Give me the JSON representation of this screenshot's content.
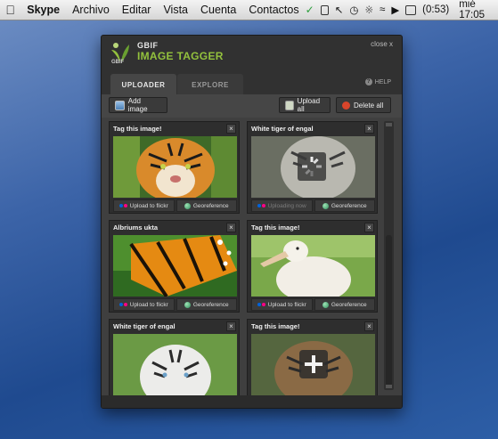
{
  "menubar": {
    "app_name": "Skype",
    "items": [
      "Archivo",
      "Editar",
      "Vista",
      "Cuenta",
      "Contactos"
    ],
    "battery": "(0:53)",
    "clock": "mié 17:05"
  },
  "window": {
    "logo_small": "GBIF",
    "logo_brand": "GBIF",
    "logo_title": "IMAGE TAGGER",
    "close_label": "close  x",
    "tabs": [
      {
        "label": "UPLOADER",
        "active": true
      },
      {
        "label": "EXPLORE",
        "active": false
      }
    ],
    "help_label": "HELP",
    "toolbar": {
      "add_image": "Add image",
      "upload_all": "Upload all",
      "delete_all": "Delete all"
    },
    "cards": [
      {
        "title": "Tag this image!",
        "upload": "Upload to flickr",
        "geo": "Georeference",
        "state": "ready",
        "image": "bengal-tiger"
      },
      {
        "title": "White tiger of engal",
        "upload": "Uploading now",
        "geo": "Georeference",
        "state": "uploading",
        "image": "white-tiger-faded"
      },
      {
        "title": "Albriums ukta",
        "upload": "Upload to flickr",
        "geo": "Georeference",
        "state": "ready",
        "image": "monarch-butterfly"
      },
      {
        "title": "Tag this image!",
        "upload": "Upload to flickr",
        "geo": "Georeference",
        "state": "ready",
        "image": "pelican"
      },
      {
        "title": "White tiger of engal",
        "upload": "",
        "geo": "",
        "state": "partial",
        "image": "white-tiger"
      },
      {
        "title": "Tag this image!",
        "upload": "",
        "geo": "",
        "state": "add",
        "image": "tiger-plus"
      }
    ],
    "colors": {
      "accent_green": "#93c13d",
      "flickr_blue": "#0063dc",
      "flickr_pink": "#ff0084",
      "delete_red": "#d9452b"
    }
  }
}
